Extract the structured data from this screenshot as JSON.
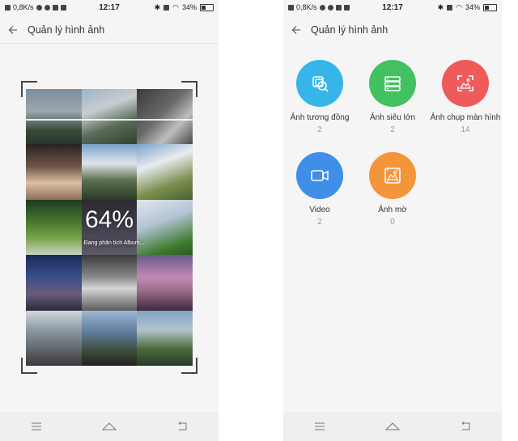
{
  "left_screen": {
    "status_bar": {
      "speed": "0,8K/s",
      "time": "12:17",
      "battery": "34%"
    },
    "app_bar": {
      "title": "Quản lý hình ảnh"
    },
    "scan": {
      "percent": "64%",
      "status": "Đang phân tích Album..."
    }
  },
  "right_screen": {
    "status_bar": {
      "speed": "0,8K/s",
      "time": "12:17",
      "battery": "34%"
    },
    "app_bar": {
      "title": "Quản lý hình ảnh"
    },
    "categories": [
      {
        "label": "Ảnh tương đồng",
        "count": "2",
        "color": "#35b5e8",
        "icon": "similar-photos-icon"
      },
      {
        "label": "Ảnh siêu lớn",
        "count": "2",
        "color": "#43c061",
        "icon": "large-photos-icon"
      },
      {
        "label": "Ảnh chụp màn hình",
        "count": "14",
        "color": "#ef5b5b",
        "icon": "screenshot-icon"
      },
      {
        "label": "Video",
        "count": "2",
        "color": "#3f8ee8",
        "icon": "video-icon"
      },
      {
        "label": "Ảnh mờ",
        "count": "0",
        "color": "#f5953a",
        "icon": "blurry-photo-icon"
      }
    ]
  }
}
